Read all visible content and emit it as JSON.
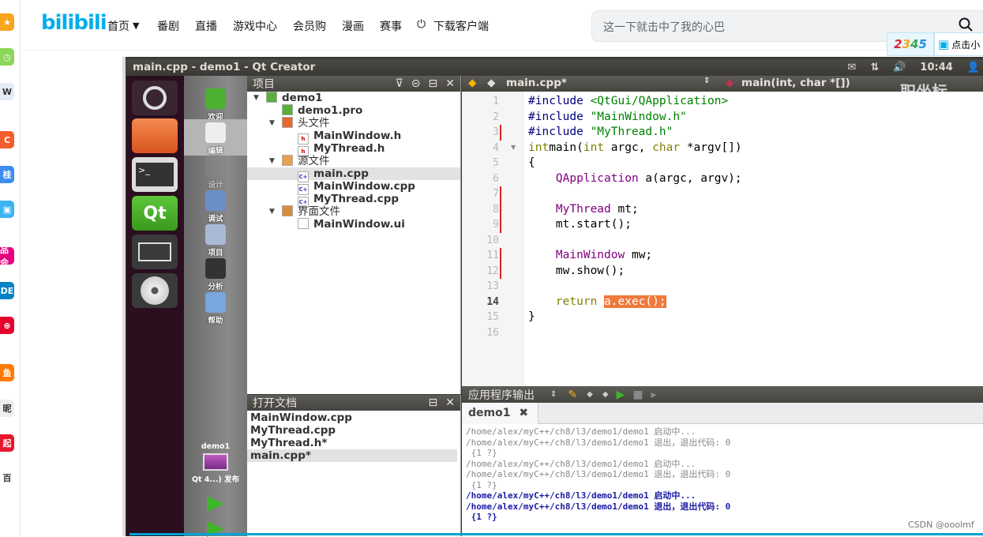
{
  "browser": {
    "logo": "bilibili",
    "nav": [
      "首页",
      "番剧",
      "直播",
      "游戏中心",
      "会员购",
      "漫画",
      "赛事",
      "下载客户端"
    ],
    "search_placeholder": "这一下就击中了我的心巴",
    "badge_2345": "2345",
    "click_label": "点击小",
    "accent": "#00aeec",
    "sidebar_icons": [
      {
        "icon": "star-icon",
        "color": "#f7a51c",
        "text": "★"
      },
      {
        "icon": "clock-icon",
        "color": "#8cd65a",
        "text": "◷"
      },
      {
        "icon": "pdf-icon",
        "color": "#e4ecf7",
        "text": "W"
      },
      {
        "icon": "c-icon",
        "color": "#f25d2c",
        "text": "C"
      },
      {
        "icon": "gui-icon",
        "color": "#3d8ef0",
        "text": "桂"
      },
      {
        "icon": "tv-icon",
        "color": "#3db4f2",
        "text": "▣"
      },
      {
        "icon": "vip-icon",
        "color": "#e4007f",
        "text": "品会"
      },
      {
        "icon": "decathlon-icon",
        "color": "#0082c3",
        "text": "DE"
      },
      {
        "icon": "globe-icon",
        "color": "#e6002d",
        "text": "⊕"
      },
      {
        "icon": "fish-icon",
        "color": "#ff7a00",
        "text": "鱼"
      },
      {
        "icon": "ni-icon",
        "color": "#eee",
        "text": "昵"
      },
      {
        "icon": "qi-icon",
        "color": "#e6162d",
        "text": "起"
      },
      {
        "icon": "bai-icon",
        "color": "#fff",
        "text": "百"
      }
    ]
  },
  "qt": {
    "title": "main.cpp - demo1 - Qt Creator",
    "time": "10:44",
    "modes": [
      "欢迎",
      "编辑",
      "设计",
      "调试",
      "项目",
      "分析",
      "帮助"
    ],
    "target": {
      "project": "demo1",
      "kit": "Qt 4...) 发布"
    },
    "project_panel": {
      "title": "项目",
      "tree": [
        {
          "label": "demo1",
          "level": 0,
          "expand": true,
          "icon": "qt-project-icon"
        },
        {
          "label": "demo1.pro",
          "level": 1,
          "icon": "pro-file-icon"
        },
        {
          "label": "头文件",
          "level": 1,
          "expand": true,
          "icon": "header-folder-icon"
        },
        {
          "label": "MainWindow.h",
          "level": 2,
          "icon": "h-file-icon"
        },
        {
          "label": "MyThread.h",
          "level": 2,
          "icon": "h-file-icon"
        },
        {
          "label": "源文件",
          "level": 1,
          "expand": true,
          "icon": "source-folder-icon"
        },
        {
          "label": "main.cpp",
          "level": 2,
          "icon": "cpp-file-icon",
          "selected": true
        },
        {
          "label": "MainWindow.cpp",
          "level": 2,
          "icon": "cpp-file-icon"
        },
        {
          "label": "MyThread.cpp",
          "level": 2,
          "icon": "cpp-file-icon"
        },
        {
          "label": "界面文件",
          "level": 1,
          "expand": true,
          "icon": "form-folder-icon"
        },
        {
          "label": "MainWindow.ui",
          "level": 2,
          "icon": "ui-file-icon"
        }
      ]
    },
    "open_docs": {
      "title": "打开文档",
      "items": [
        "MainWindow.cpp",
        "MyThread.cpp",
        "MyThread.h*",
        "main.cpp*"
      ],
      "selected": 3
    },
    "editor": {
      "file": "main.cpp*",
      "symbol": "main(int, char *[])",
      "current_line": 14,
      "lines": [
        [
          [
            "pp",
            "#include "
          ],
          [
            "st",
            "<QtGui/QApplication>"
          ]
        ],
        [
          [
            "pp",
            "#include "
          ],
          [
            "st",
            "\"MainWindow.h\""
          ]
        ],
        [
          [
            "pp",
            "#include "
          ],
          [
            "st",
            "\"MyThread.h\""
          ]
        ],
        [
          [
            "kw",
            "int"
          ],
          [
            "",
            "main("
          ],
          [
            "kw",
            "int"
          ],
          [
            "",
            " argc, "
          ],
          [
            "kw",
            "char"
          ],
          [
            "",
            " *argv[])"
          ]
        ],
        [
          [
            "",
            "{"
          ]
        ],
        [
          [
            "",
            "    "
          ],
          [
            "ty",
            "QApplication"
          ],
          [
            "",
            " a(argc, argv);"
          ]
        ],
        [],
        [
          [
            "",
            "    "
          ],
          [
            "ty",
            "MyThread"
          ],
          [
            "",
            " mt;"
          ]
        ],
        [
          [
            "",
            "    mt.start();"
          ]
        ],
        [],
        [
          [
            "",
            "    "
          ],
          [
            "ty",
            "MainWindow"
          ],
          [
            "",
            " mw;"
          ]
        ],
        [
          [
            "",
            "    mw.show();"
          ]
        ],
        [],
        [
          [
            "",
            "    "
          ],
          [
            "kw",
            "return"
          ],
          [
            "",
            " "
          ],
          [
            "hl",
            "a.exec();"
          ]
        ],
        [
          [
            "",
            "}"
          ]
        ],
        []
      ],
      "modified_lines": [
        3,
        7,
        8,
        9,
        11,
        12
      ]
    },
    "output": {
      "title": "应用程序输出",
      "tab": "demo1",
      "lines": [
        {
          "t": "/home/alex/myC++/ch8/l3/demo1/demo1 启动中...",
          "s": "g"
        },
        {
          "t": "/home/alex/myC++/ch8/l3/demo1/demo1 退出，退出代码: 0",
          "s": "g"
        },
        {
          "t": " {1 ?}",
          "s": "g"
        },
        {
          "t": "/home/alex/myC++/ch8/l3/demo1/demo1 启动中...",
          "s": "g"
        },
        {
          "t": "/home/alex/myC++/ch8/l3/demo1/demo1 退出，退出代码: 0",
          "s": "g"
        },
        {
          "t": " {1 ?}",
          "s": "g"
        },
        {
          "t": "/home/alex/myC++/ch8/l3/demo1/demo1 启动中...",
          "s": "b"
        },
        {
          "t": "/home/alex/myC++/ch8/l3/demo1/demo1 退出，退出代码: 0",
          "s": "b"
        },
        {
          "t": " {1 ?}",
          "s": "b"
        }
      ]
    }
  },
  "watermark": "CSDN @ooolmf",
  "overlay_text": "职坐标"
}
